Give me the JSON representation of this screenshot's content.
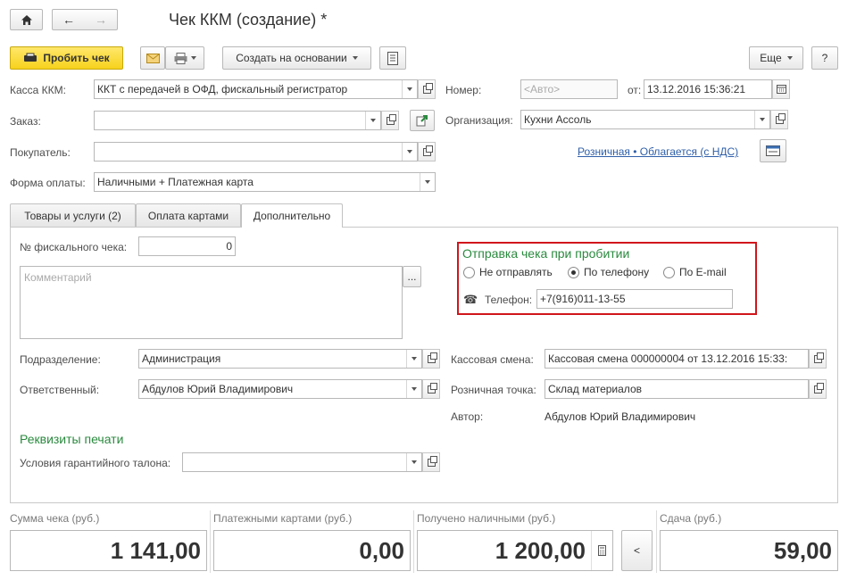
{
  "window": {
    "title": "Чек ККМ (создание) *"
  },
  "toolbar": {
    "punch_label": "Пробить чек",
    "create_based_label": "Создать на основании",
    "more_label": "Еще",
    "help_label": "?"
  },
  "form": {
    "kassa_label": "Касса ККМ:",
    "kassa_value": "ККТ с передачей в ОФД, фискальный регистратор",
    "order_label": "Заказ:",
    "order_value": "",
    "buyer_label": "Покупатель:",
    "buyer_value": "",
    "payment_label": "Форма оплаты:",
    "payment_value": "Наличными + Платежная карта",
    "number_label": "Номер:",
    "number_placeholder": "<Авто>",
    "date_label": "от:",
    "date_value": "13.12.2016 15:36:21",
    "org_label": "Организация:",
    "org_value": "Кухни Ассоль",
    "tax_link": "Розничная • Облагается (с НДС)"
  },
  "tabs": [
    {
      "label": "Товары и услуги (2)"
    },
    {
      "label": "Оплата картами"
    },
    {
      "label": "Дополнительно"
    }
  ],
  "extra": {
    "fiscal_label": "№ фискального чека:",
    "fiscal_value": "0",
    "comment_placeholder": "Комментарий",
    "comment_btn": "...",
    "dept_label": "Подразделение:",
    "dept_value": "Администрация",
    "resp_label": "Ответственный:",
    "resp_value": "Абдулов Юрий Владимирович",
    "shift_label": "Кассовая смена:",
    "shift_value": "Кассовая смена 000000004 от 13.12.2016 15:33:",
    "point_label": "Розничная точка:",
    "point_value": "Склад материалов",
    "author_label": "Автор:",
    "author_value": "Абдулов Юрий Владимирович",
    "print_section": "Реквизиты печати",
    "warranty_label": "Условия гарантийного талона:",
    "warranty_value": ""
  },
  "send": {
    "title": "Отправка чека при пробитии",
    "options": [
      "Не отправлять",
      "По телефону",
      "По E-mail"
    ],
    "selected": 1,
    "phone_label": "Телефон:",
    "phone_value": "+7(916)011-13-55"
  },
  "summary": {
    "total_label": "Сумма чека (руб.)",
    "total_value": "1 141,00",
    "cards_label": "Платежными картами (руб.)",
    "cards_value": "0,00",
    "cash_label": "Получено наличными (руб.)",
    "cash_value": "1 200,00",
    "back_btn": "<",
    "change_label": "Сдача (руб.)",
    "change_value": "59,00"
  },
  "colors": {
    "accent_green": "#2a8a3e",
    "highlight_red": "#d0161b",
    "primary_yellow": "#f7d21c",
    "link_blue": "#2f5fa8"
  }
}
